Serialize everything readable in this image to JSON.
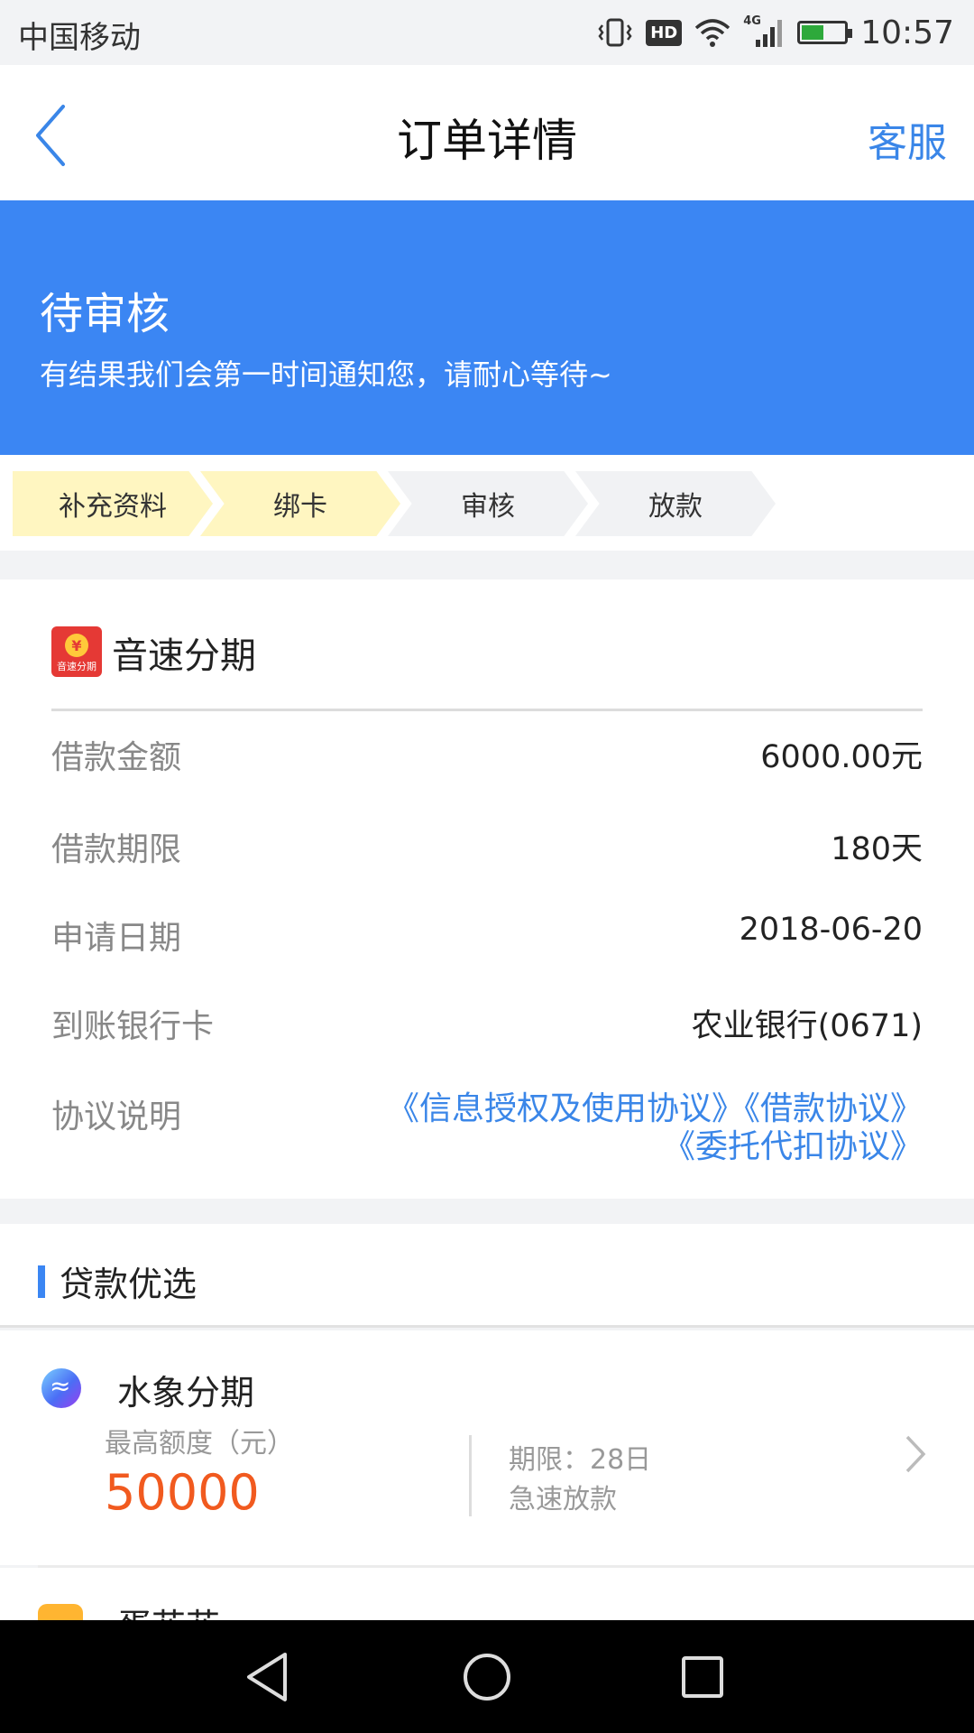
{
  "status_bar": {
    "carrier": "中国移动",
    "hd": "HD",
    "network": "4G",
    "time": "10:57"
  },
  "nav": {
    "title": "订单详情",
    "right_action": "客服",
    "back_icon": "chevron-left-icon"
  },
  "banner": {
    "title": "待审核",
    "subtitle": "有结果我们会第一时间通知您，请耐心等待~"
  },
  "steps": [
    {
      "label": "补充资料",
      "state": "done"
    },
    {
      "label": "绑卡",
      "state": "done"
    },
    {
      "label": "审核",
      "state": "todo"
    },
    {
      "label": "放款",
      "state": "todo"
    }
  ],
  "order": {
    "product_name": "音速分期",
    "logo_text": "音速分期",
    "logo_symbol": "¥",
    "rows": [
      {
        "label": "借款金额",
        "value": "6000.00元"
      },
      {
        "label": "借款期限",
        "value": "180天"
      },
      {
        "label": "申请日期",
        "value": "2018-06-20"
      },
      {
        "label": "到账银行卡",
        "value": "农业银行(0671)"
      }
    ],
    "agreement_label": "协议说明",
    "agreements": [
      "《信息授权及使用协议》",
      "《借款协议》",
      "《委托代扣协议》"
    ]
  },
  "recommend": {
    "title": "贷款优选",
    "items": [
      {
        "name": "水象分期",
        "limit_label": "最高额度（元）",
        "amount": "50000",
        "term": "期限：28日",
        "feature": "急速放款"
      },
      {
        "name": "蛋花花"
      }
    ]
  },
  "colors": {
    "primary": "#3b86f3",
    "link": "#3a86e8",
    "amount": "#f15a1f",
    "step_done": "#fff6c1",
    "step_todo": "#f1f2f4"
  }
}
